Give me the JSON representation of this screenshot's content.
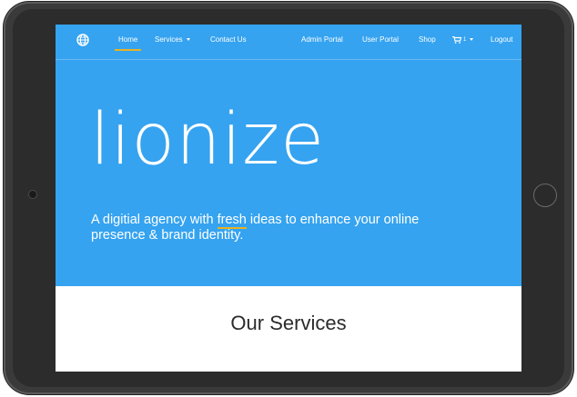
{
  "nav": {
    "home": "Home",
    "services": "Services",
    "contact": "Contact Us",
    "admin_portal": "Admin Portal",
    "user_portal": "User Portal",
    "shop": "Shop",
    "cart_count": "1",
    "logout": "Logout"
  },
  "hero": {
    "title": "lionize",
    "tagline_before": "A digitial agency with ",
    "tagline_highlight": "fresh",
    "tagline_after": " ideas to enhance your online presence & brand identity."
  },
  "services": {
    "title": "Our Services"
  },
  "colors": {
    "hero_background": "#35a3f0",
    "accent_underline": "#e8b320",
    "page_background": "#ffffff"
  },
  "icons": {
    "logo": "globe-icon",
    "cart": "cart-icon"
  }
}
